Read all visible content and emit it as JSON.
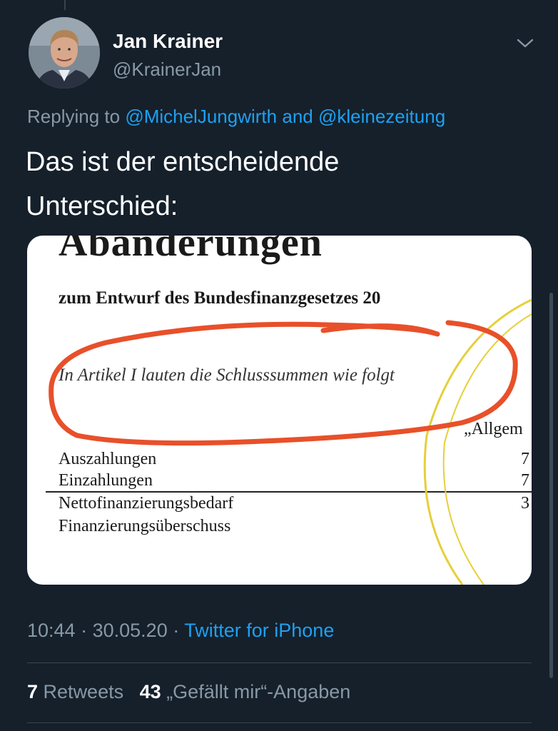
{
  "author": {
    "name": "Jan Krainer",
    "handle": "@KrainerJan",
    "avatar_icon": "avatar-photo"
  },
  "reply": {
    "prefix": "Replying to",
    "mention1": "@MichelJungwirth",
    "conj": "and",
    "mention2": "@kleinezeitung"
  },
  "tweet": {
    "line1": "Das ist der entscheidende",
    "line2": "Unterschied:"
  },
  "media": {
    "title": "Abänderungen",
    "subtitle": "zum Entwurf des Bundesfinanzgesetzes 20",
    "italic": "In Artikel I lauten die Schlusssummen wie folgt",
    "column_header": "„Allgem",
    "rows": [
      {
        "label": "Auszahlungen",
        "value": "7"
      },
      {
        "label": "Einzahlungen",
        "value": "7"
      },
      {
        "label": "Nettofinanzierungsbedarf",
        "value": "3"
      },
      {
        "label": "Finanzierungsüberschuss",
        "value": ""
      }
    ],
    "highlight_color": "#e8502a",
    "circle_color": "#e6cf3a"
  },
  "meta": {
    "time": "10:44",
    "dot1": "·",
    "date": "30.05.20",
    "dot2": "·",
    "source": "Twitter for iPhone"
  },
  "stats": {
    "retweets_count": "7",
    "retweets_label": "Retweets",
    "likes_count": "43",
    "likes_label": "„Gefällt mir“-Angaben"
  },
  "colors": {
    "background": "#15202b",
    "link": "#1da1f2",
    "muted": "#8899a6"
  }
}
